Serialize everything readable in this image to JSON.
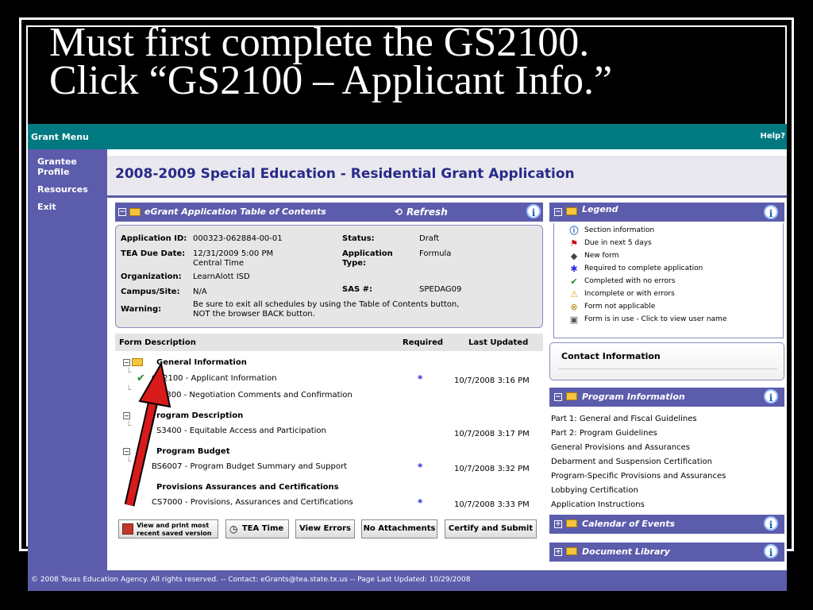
{
  "slide": {
    "title_line1": "Must first complete the GS2100.",
    "title_line2": "Click “GS2100 – Applicant Info.”"
  },
  "topbar": {
    "menu": "Grant Menu",
    "help": "Help?"
  },
  "sidebar": {
    "items": [
      {
        "label": "Grantee Profile"
      },
      {
        "label": "Resources"
      },
      {
        "label": "Exit"
      }
    ]
  },
  "page": {
    "title": "2008-2009 Special Education - Residential Grant Application"
  },
  "toc": {
    "title": "eGrant Application Table of Contents",
    "refresh": "Refresh"
  },
  "info": {
    "app_id_label": "Application ID:",
    "app_id": "000323-062884-00-01",
    "status_label": "Status:",
    "status": "Draft",
    "due_label": "TEA Due Date:",
    "due_line1": "12/31/2009 5:00 PM",
    "due_line2": "Central Time",
    "type_label_1": "Application",
    "type_label_2": "Type:",
    "type": "Formula",
    "org_label": "Organization:",
    "org": "LearnAlott ISD",
    "campus_label": "Campus/Site:",
    "campus": "N/A",
    "sas_label": "SAS #:",
    "sas": "SPEDAG09",
    "warning_label": "Warning:",
    "warning_line1": "Be sure to exit all schedules by using the Table of Contents button,",
    "warning_line2": "NOT the browser BACK button."
  },
  "forms": {
    "headers": {
      "desc": "Form Description",
      "required": "Required",
      "updated": "Last Updated"
    },
    "groups": [
      {
        "label": "General Information"
      },
      {
        "label": "Program Description"
      },
      {
        "label": "Program Budget"
      },
      {
        "label": "Provisions Assurances and Certifications"
      }
    ],
    "items": [
      {
        "label": "GS2100 - Applicant Information",
        "required": "*",
        "updated": "10/7/2008 3:16 PM"
      },
      {
        "label": "2300 - Negotiation Comments and Confirmation",
        "required": "",
        "updated": ""
      },
      {
        "label": "S3400 - Equitable Access and Participation",
        "required": "",
        "updated": "10/7/2008 3:17 PM"
      },
      {
        "label": "BS6007 - Program Budget Summary and Support",
        "required": "*",
        "updated": "10/7/2008 3:32 PM"
      },
      {
        "label": "CS7000 - Provisions, Assurances and Certifications",
        "required": "*",
        "updated": "10/7/2008 3:33 PM"
      }
    ],
    "group_label_partial": "rogram Description"
  },
  "buttons": {
    "print_line1": "View and print most",
    "print_line2": "recent saved version",
    "tea_time": "TEA Time",
    "view_errors": "View Errors",
    "no_attachments": "No Attachments",
    "certify": "Certify and Submit"
  },
  "legend": {
    "title": "Legend",
    "items": [
      {
        "label": "Section information"
      },
      {
        "label": "Due in next 5 days"
      },
      {
        "label": "New form"
      },
      {
        "label": "Required to complete application"
      },
      {
        "label": "Completed with no errors"
      },
      {
        "label": "Incomplete or with errors"
      },
      {
        "label": "Form not applicable"
      },
      {
        "label": "Form is in use - Click to view user name"
      }
    ]
  },
  "contact": {
    "title": "Contact Information"
  },
  "program": {
    "title": "Program Information",
    "links": [
      {
        "label": "Part 1: General and Fiscal Guidelines"
      },
      {
        "label": "Part 2: Program Guidelines"
      },
      {
        "label": "General Provisions and Assurances"
      },
      {
        "label": "Debarment and Suspension Certification"
      },
      {
        "label": "Program-Specific Provisions and Assurances"
      },
      {
        "label": "Lobbying Certification"
      },
      {
        "label": "Application Instructions"
      }
    ]
  },
  "calendar": {
    "title": "Calendar of Events"
  },
  "library": {
    "title": "Document Library"
  },
  "footer": {
    "text": "© 2008 Texas Education Agency. All rights reserved. -- Contact: eGrants@tea.state.tx.us -- Page Last Updated: 10/29/2008"
  }
}
